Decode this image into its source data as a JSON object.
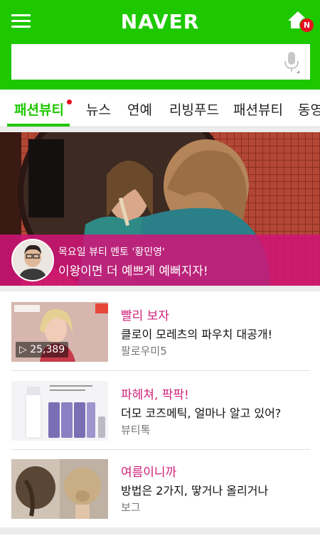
{
  "header": {
    "logo": "NAVER",
    "badge": "N",
    "icons": [
      "menu-icon",
      "home-icon",
      "mic-icon"
    ]
  },
  "search": {
    "value": ""
  },
  "tabs": [
    {
      "label": "패션뷰티",
      "active": true
    },
    {
      "label": "뉴스"
    },
    {
      "label": "연예"
    },
    {
      "label": "리빙푸드"
    },
    {
      "label": "패션뷰티"
    },
    {
      "label": "동영"
    }
  ],
  "hero": {
    "kicker": "목요일 뷰티 멘토 '황민영'",
    "title": "이왕이면 더 예쁘게 예뻐지자!"
  },
  "items": [
    {
      "category": "빨리 보자",
      "title": "클로이 모레츠의 파우치 대공개!",
      "source": "팔로우미5",
      "views": "25,389"
    },
    {
      "category": "파헤쳐, 팍팍!",
      "title": "더모 코즈메틱, 얼마나 알고 있어?",
      "source": "뷰티톡"
    },
    {
      "category": "여름이니까",
      "title": "방법은 2가지, 땋거나 올리거나",
      "source": "보그"
    }
  ],
  "colors": {
    "brand": "#1ec800",
    "accent": "#d0207a",
    "badge": "#e5101f"
  }
}
